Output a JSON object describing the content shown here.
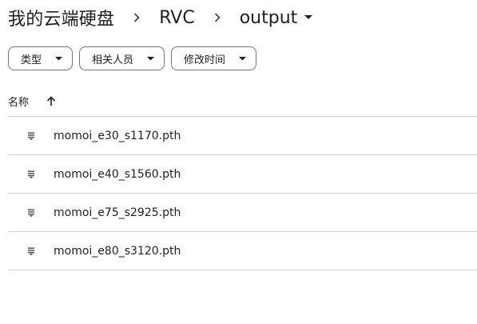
{
  "breadcrumb": {
    "items": [
      "我的云端硬盘",
      "RVC"
    ],
    "current": "output"
  },
  "filters": [
    {
      "label": "类型"
    },
    {
      "label": "相关人员"
    },
    {
      "label": "修改时间"
    }
  ],
  "columns": {
    "name_label": "名称",
    "sort_direction": "ascending"
  },
  "files": [
    {
      "name": "momoi_e30_s1170.pth",
      "icon": "file-lines-icon"
    },
    {
      "name": "momoi_e40_s1560.pth",
      "icon": "file-lines-icon"
    },
    {
      "name": "momoi_e75_s2925.pth",
      "icon": "file-lines-icon"
    },
    {
      "name": "momoi_e80_s3120.pth",
      "icon": "file-lines-icon"
    }
  ],
  "colors": {
    "text": "#1f1f1f",
    "icon": "#444746",
    "chip_border": "#747775",
    "divider": "#d3d3d3"
  }
}
